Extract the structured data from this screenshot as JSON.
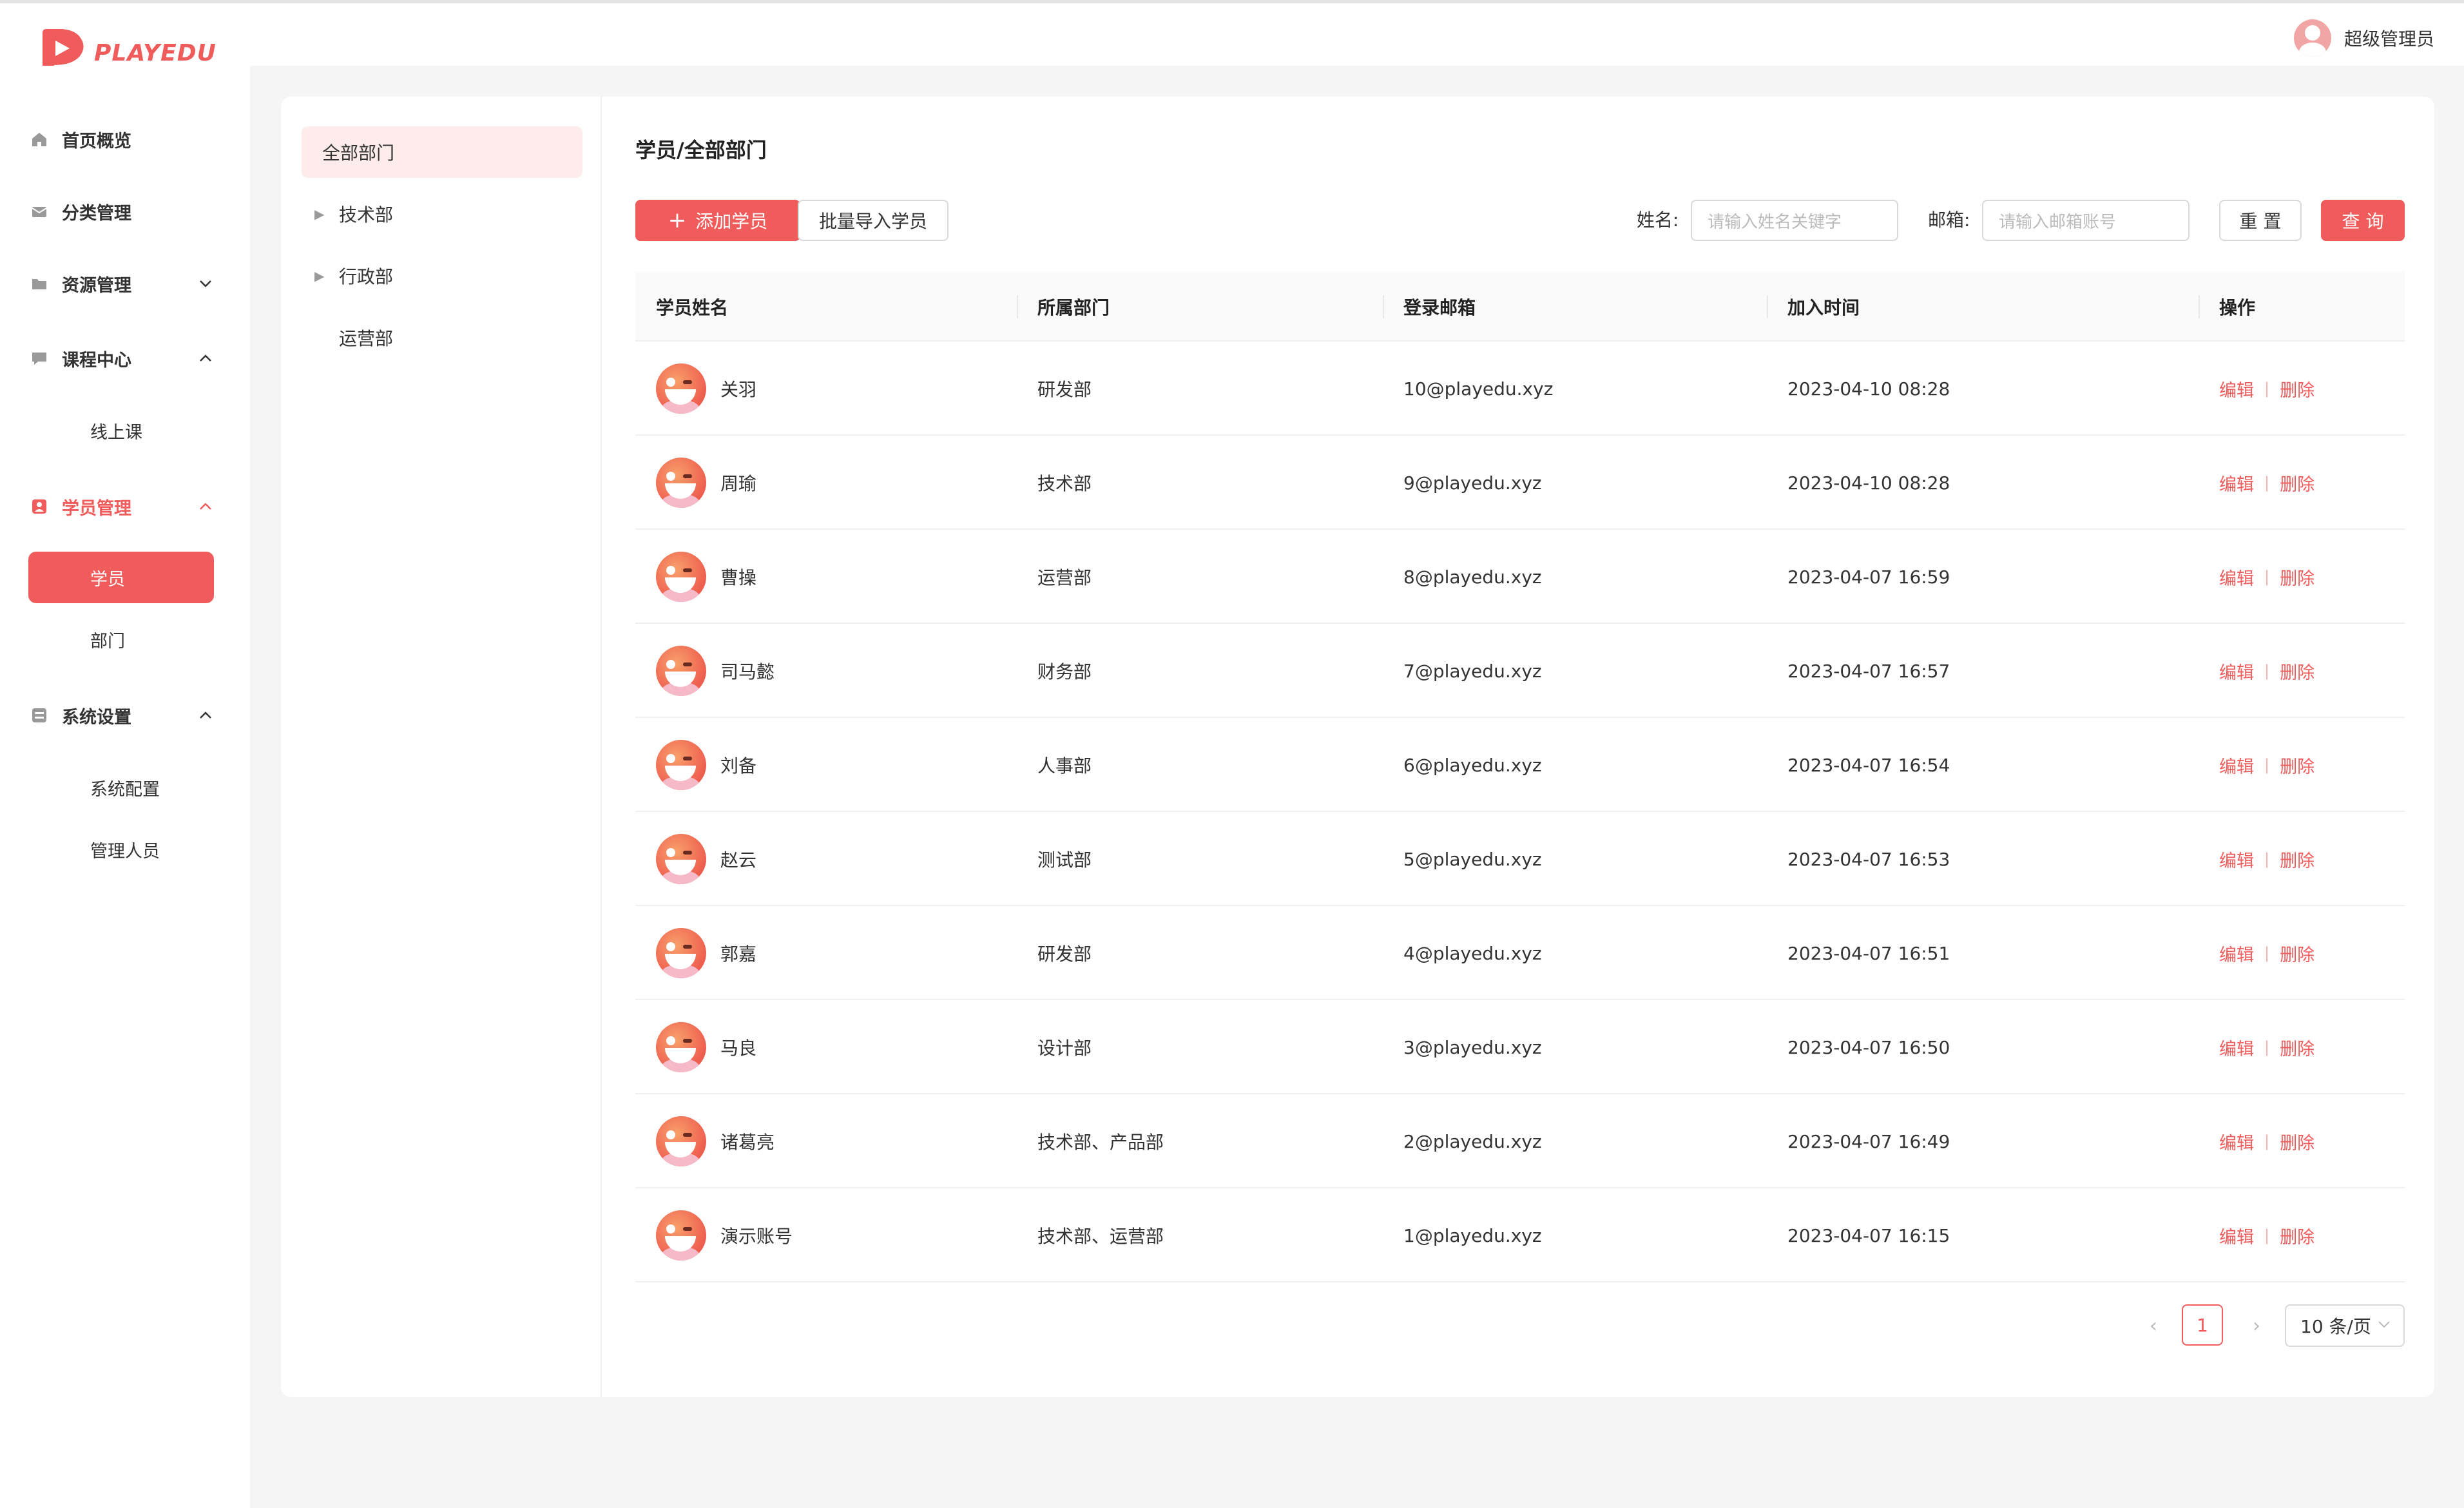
{
  "brand": {
    "name": "PLAYEDU",
    "color": "#f05b5b"
  },
  "user": {
    "name": "超级管理员"
  },
  "sidebar": {
    "items": [
      {
        "label": "首页概览",
        "icon": "home-icon"
      },
      {
        "label": "分类管理",
        "icon": "mail-icon"
      },
      {
        "label": "资源管理",
        "icon": "folder-icon",
        "arrow": "down"
      },
      {
        "label": "课程中心",
        "icon": "message-icon",
        "arrow": "up"
      },
      {
        "label": "学员管理",
        "icon": "user-card-icon",
        "arrow": "up",
        "active": true
      },
      {
        "label": "系统设置",
        "icon": "settings-box-icon",
        "arrow": "up"
      }
    ],
    "sub": {
      "course": [
        "线上课"
      ],
      "student": [
        "学员",
        "部门"
      ],
      "system": [
        "系统配置",
        "管理人员"
      ]
    }
  },
  "departments": [
    "全部部门",
    "技术部",
    "行政部",
    "运营部"
  ],
  "main": {
    "breadcrumb": "学员/全部部门",
    "add_button": "添加学员",
    "import_button": "批量导入学员",
    "filters": {
      "name_label": "姓名:",
      "name_placeholder": "请输入姓名关键字",
      "email_label": "邮箱:",
      "email_placeholder": "请输入邮箱账号"
    },
    "reset_button": "重 置",
    "query_button": "查 询"
  },
  "table": {
    "columns": [
      "学员姓名",
      "所属部门",
      "登录邮箱",
      "加入时间",
      "操作"
    ],
    "rows": [
      {
        "name": "关羽",
        "dept": "研发部",
        "email": "10@playedu.xyz",
        "time": "2023-04-10 08:28"
      },
      {
        "name": "周瑜",
        "dept": "技术部",
        "email": "9@playedu.xyz",
        "time": "2023-04-10 08:28"
      },
      {
        "name": "曹操",
        "dept": "运营部",
        "email": "8@playedu.xyz",
        "time": "2023-04-07 16:59"
      },
      {
        "name": "司马懿",
        "dept": "财务部",
        "email": "7@playedu.xyz",
        "time": "2023-04-07 16:57"
      },
      {
        "name": "刘备",
        "dept": "人事部",
        "email": "6@playedu.xyz",
        "time": "2023-04-07 16:54"
      },
      {
        "name": "赵云",
        "dept": "测试部",
        "email": "5@playedu.xyz",
        "time": "2023-04-07 16:53"
      },
      {
        "name": "郭嘉",
        "dept": "研发部",
        "email": "4@playedu.xyz",
        "time": "2023-04-07 16:51"
      },
      {
        "name": "马良",
        "dept": "设计部",
        "email": "3@playedu.xyz",
        "time": "2023-04-07 16:50"
      },
      {
        "name": "诸葛亮",
        "dept": "技术部、产品部",
        "email": "2@playedu.xyz",
        "time": "2023-04-07 16:49"
      },
      {
        "name": "演示账号",
        "dept": "技术部、运营部",
        "email": "1@playedu.xyz",
        "time": "2023-04-07 16:15"
      }
    ],
    "edit_label": "编辑",
    "delete_label": "删除",
    "op_separator": "|"
  },
  "pagination": {
    "current": "1",
    "page_size": "10 条/页"
  }
}
